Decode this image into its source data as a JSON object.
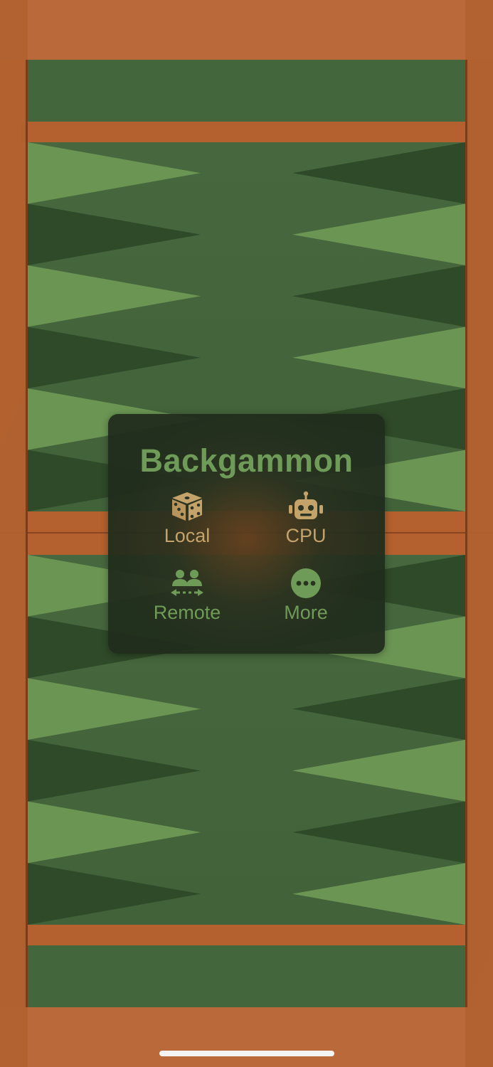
{
  "app": {
    "title": "Backgammon"
  },
  "menu": {
    "options": {
      "local": {
        "label": "Local",
        "icon": "dice-icon"
      },
      "cpu": {
        "label": "CPU",
        "icon": "robot-icon"
      },
      "remote": {
        "label": "Remote",
        "icon": "remote-players-icon"
      },
      "more": {
        "label": "More",
        "icon": "ellipsis-circle-icon"
      }
    }
  },
  "colors": {
    "felt": "#44663c",
    "point_light": "#6b9553",
    "point_dark": "#2f4a28",
    "wood": "#b0622f",
    "menu_title": "#6f9b58",
    "menu_option_gold": "#c4a36a",
    "menu_option_green": "#6f9b58"
  }
}
